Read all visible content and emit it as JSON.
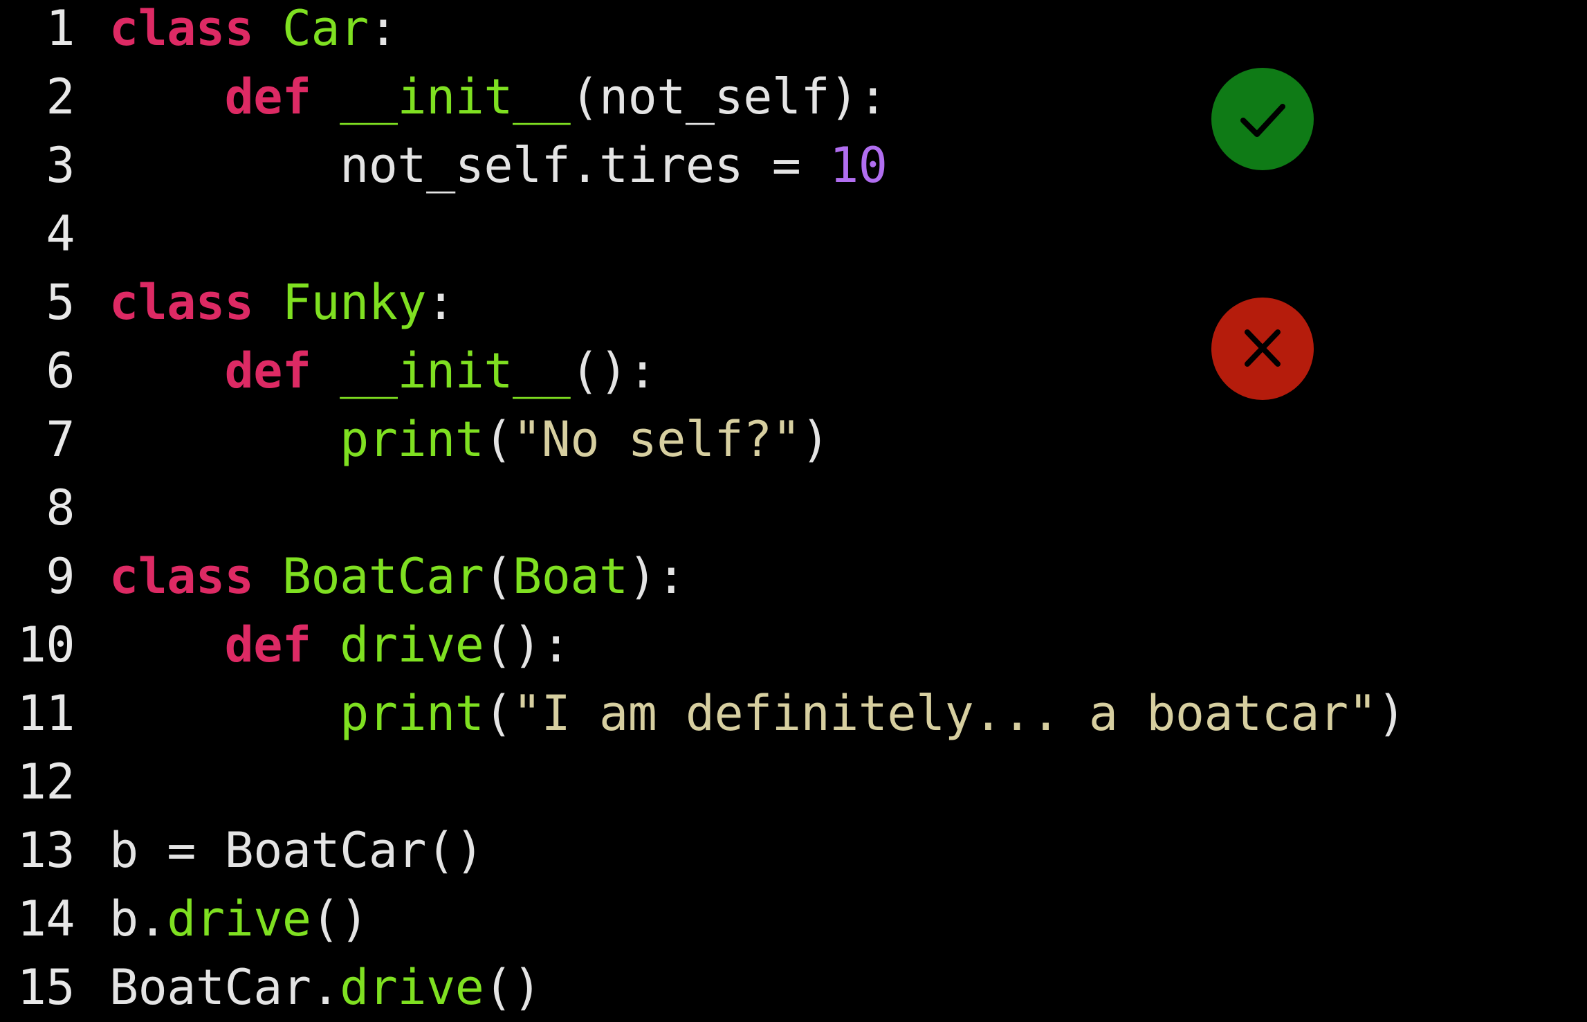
{
  "code": {
    "lines": [
      {
        "n": "1",
        "tokens": [
          {
            "t": "class",
            "c": "kw"
          },
          {
            "t": " ",
            "c": "plain"
          },
          {
            "t": "Car",
            "c": "fn"
          },
          {
            "t": ":",
            "c": "plain"
          }
        ]
      },
      {
        "n": "2",
        "tokens": [
          {
            "t": "    ",
            "c": "plain"
          },
          {
            "t": "def",
            "c": "kw"
          },
          {
            "t": " ",
            "c": "plain"
          },
          {
            "t": "__init__",
            "c": "fn"
          },
          {
            "t": "(not_self):",
            "c": "plain"
          }
        ]
      },
      {
        "n": "3",
        "tokens": [
          {
            "t": "        not_self.tires = ",
            "c": "plain"
          },
          {
            "t": "10",
            "c": "num"
          }
        ]
      },
      {
        "n": "4",
        "tokens": []
      },
      {
        "n": "5",
        "tokens": [
          {
            "t": "class",
            "c": "kw"
          },
          {
            "t": " ",
            "c": "plain"
          },
          {
            "t": "Funky",
            "c": "fn"
          },
          {
            "t": ":",
            "c": "plain"
          }
        ]
      },
      {
        "n": "6",
        "tokens": [
          {
            "t": "    ",
            "c": "plain"
          },
          {
            "t": "def",
            "c": "kw"
          },
          {
            "t": " ",
            "c": "plain"
          },
          {
            "t": "__init__",
            "c": "fn"
          },
          {
            "t": "():",
            "c": "plain"
          }
        ]
      },
      {
        "n": "7",
        "tokens": [
          {
            "t": "        ",
            "c": "plain"
          },
          {
            "t": "print",
            "c": "fn"
          },
          {
            "t": "(",
            "c": "plain"
          },
          {
            "t": "\"No self?\"",
            "c": "str"
          },
          {
            "t": ")",
            "c": "plain"
          }
        ]
      },
      {
        "n": "8",
        "tokens": []
      },
      {
        "n": "9",
        "tokens": [
          {
            "t": "class",
            "c": "kw"
          },
          {
            "t": " ",
            "c": "plain"
          },
          {
            "t": "BoatCar",
            "c": "fn"
          },
          {
            "t": "(",
            "c": "plain"
          },
          {
            "t": "Boat",
            "c": "fn"
          },
          {
            "t": "):",
            "c": "plain"
          }
        ]
      },
      {
        "n": "10",
        "tokens": [
          {
            "t": "    ",
            "c": "plain"
          },
          {
            "t": "def",
            "c": "kw"
          },
          {
            "t": " ",
            "c": "plain"
          },
          {
            "t": "drive",
            "c": "fn"
          },
          {
            "t": "():",
            "c": "plain"
          }
        ]
      },
      {
        "n": "11",
        "tokens": [
          {
            "t": "        ",
            "c": "plain"
          },
          {
            "t": "print",
            "c": "fn"
          },
          {
            "t": "(",
            "c": "plain"
          },
          {
            "t": "\"I am definitely... a boatcar\"",
            "c": "str"
          },
          {
            "t": ")",
            "c": "plain"
          }
        ]
      },
      {
        "n": "12",
        "tokens": []
      },
      {
        "n": "13",
        "tokens": [
          {
            "t": "b = BoatCar()",
            "c": "plain"
          }
        ]
      },
      {
        "n": "14",
        "tokens": [
          {
            "t": "b.",
            "c": "plain"
          },
          {
            "t": "drive",
            "c": "fn"
          },
          {
            "t": "()",
            "c": "plain"
          }
        ]
      },
      {
        "n": "15",
        "tokens": [
          {
            "t": "BoatCar.",
            "c": "plain"
          },
          {
            "t": "drive",
            "c": "fn"
          },
          {
            "t": "()",
            "c": "plain"
          }
        ]
      }
    ]
  },
  "badges": {
    "ok": {
      "icon": "check-icon",
      "color": "#0f7b16"
    },
    "err": {
      "icon": "close-icon",
      "color": "#b51c0c"
    }
  },
  "colors": {
    "background": "#000000",
    "keyword": "#dd2a64",
    "function": "#7fe021",
    "string": "#d7cfa0",
    "number": "#b16ef0",
    "plain": "#e4e4e4"
  }
}
